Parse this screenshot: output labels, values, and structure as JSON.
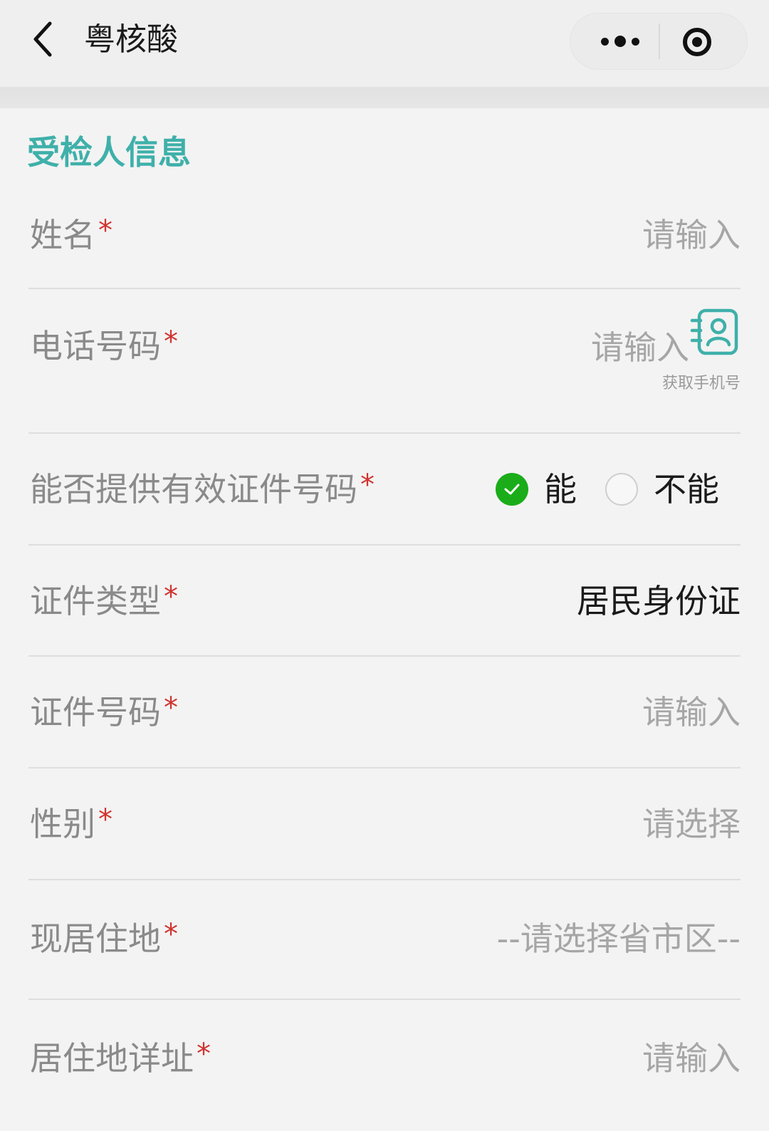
{
  "nav": {
    "title": "粤核酸",
    "back_icon": "chevron-left-icon",
    "more_icon": "more-dots-icon",
    "close_icon": "target-circle-icon"
  },
  "form": {
    "section_title": "受检人信息",
    "required_mark": "*",
    "accent_color": "#3fb0aa",
    "required_color": "#d0332f",
    "rows": [
      {
        "label": "姓名",
        "placeholder": "请输入"
      },
      {
        "label": "电话号码",
        "placeholder": "请输入",
        "hint": "获取手机号",
        "icon": "contact-card-icon"
      },
      {
        "label": "能否提供有效证件号码",
        "options": [
          "能",
          "不能"
        ],
        "selected": "能"
      },
      {
        "label": "证件类型",
        "value": "居民身份证"
      },
      {
        "label": "证件号码",
        "placeholder": "请输入"
      },
      {
        "label": "性别",
        "placeholder": "请选择"
      },
      {
        "label": "现居住地",
        "placeholder": "--请选择省市区--"
      },
      {
        "label": "居住地详址",
        "placeholder": "请输入"
      }
    ]
  }
}
